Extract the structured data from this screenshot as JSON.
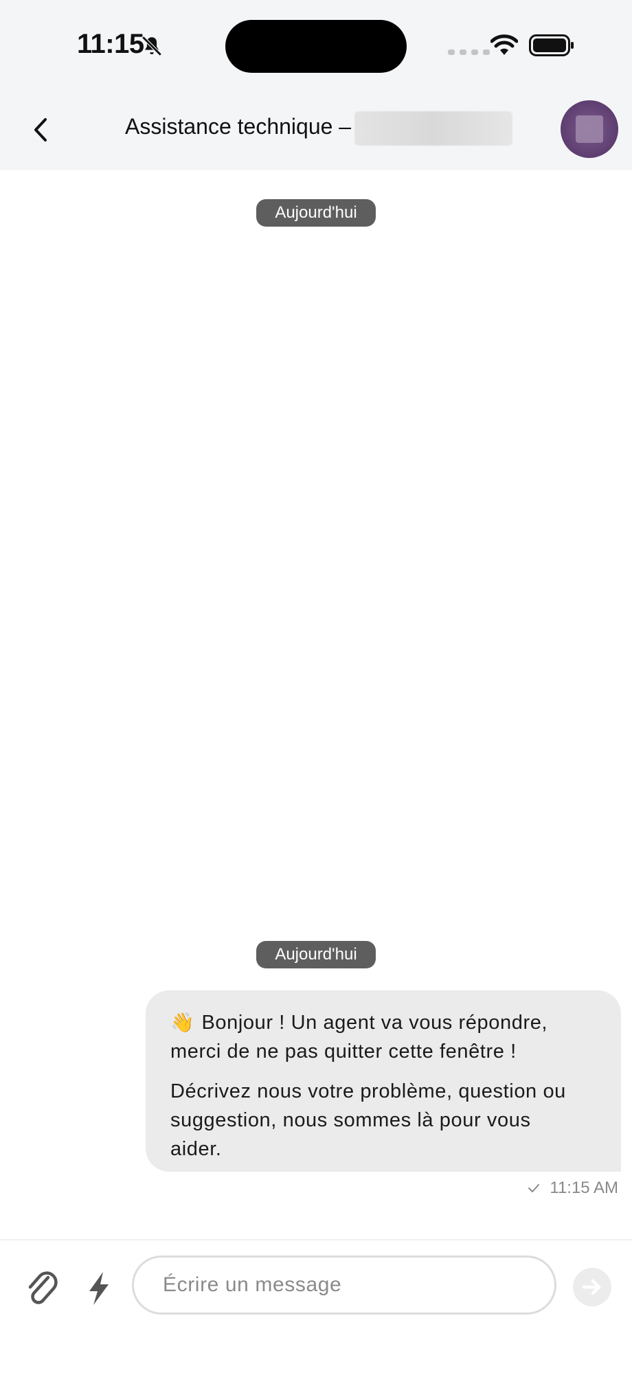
{
  "status_bar": {
    "time": "11:15"
  },
  "header": {
    "title": "Assistance technique –"
  },
  "chat": {
    "date_separators": [
      "Aujourd'hui",
      "Aujourd'hui"
    ],
    "message": {
      "emoji": "👋",
      "line1": "Bonjour ! Un agent va vous répondre,",
      "line2": "merci de ne pas quitter cette fenêtre !",
      "line3": "Décrivez nous votre problème, question ou",
      "line4": "suggestion, nous sommes là pour vous",
      "line5": "aider.",
      "time": "11:15 AM"
    }
  },
  "composer": {
    "placeholder": "Écrire un message"
  },
  "icons": {
    "back": "chevron-left-icon",
    "bell": "bell-slash-icon",
    "attach": "paperclip-icon",
    "quick": "lightning-icon",
    "send": "arrow-right-icon",
    "check": "check-icon"
  },
  "colors": {
    "header_bg": "#f4f5f7",
    "bubble_bg": "#ebebeb",
    "date_pill_bg": "#5e5e5e",
    "avatar": "#6a4a7c"
  }
}
